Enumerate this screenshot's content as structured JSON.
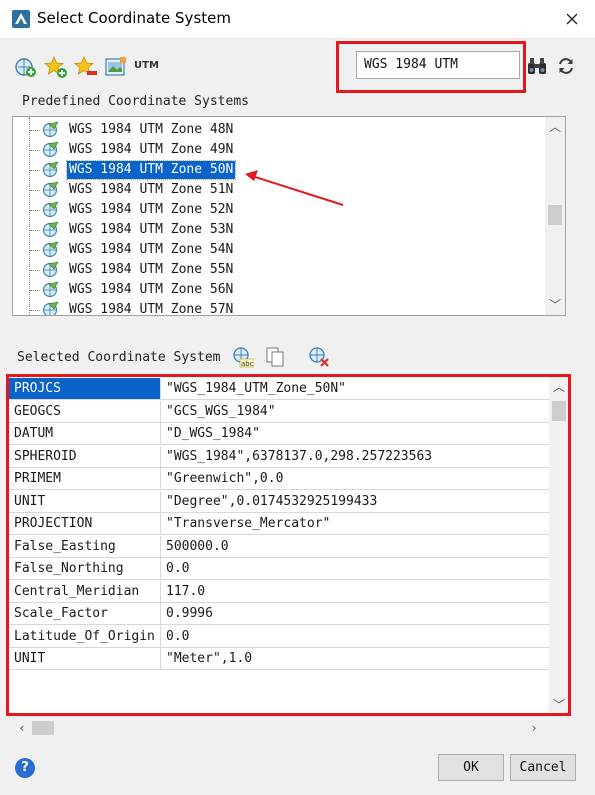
{
  "window": {
    "title": "Select Coordinate System"
  },
  "toolbar": {
    "utm_label": "UTM",
    "search_value": "WGS 1984 UTM",
    "icons": [
      "new-coordinate-system-icon",
      "add-favorite-icon",
      "remove-favorite-icon",
      "import-projection-icon",
      "find-icon",
      "refresh-icon"
    ]
  },
  "predefined": {
    "label": "Predefined Coordinate Systems",
    "items": [
      {
        "label": "WGS 1984 UTM Zone 48N",
        "selected": false
      },
      {
        "label": "WGS 1984 UTM Zone 49N",
        "selected": false
      },
      {
        "label": "WGS 1984 UTM Zone 50N",
        "selected": true
      },
      {
        "label": "WGS 1984 UTM Zone 51N",
        "selected": false
      },
      {
        "label": "WGS 1984 UTM Zone 52N",
        "selected": false
      },
      {
        "label": "WGS 1984 UTM Zone 53N",
        "selected": false
      },
      {
        "label": "WGS 1984 UTM Zone 54N",
        "selected": false
      },
      {
        "label": "WGS 1984 UTM Zone 55N",
        "selected": false
      },
      {
        "label": "WGS 1984 UTM Zone 56N",
        "selected": false
      },
      {
        "label": "WGS 1984 UTM Zone 57N",
        "selected": false
      }
    ]
  },
  "selected": {
    "label": "Selected Coordinate System",
    "properties": [
      {
        "key": "PROJCS",
        "value": "\"WGS_1984_UTM_Zone_50N\"",
        "selected": true
      },
      {
        "key": "GEOGCS",
        "value": "\"GCS_WGS_1984\"",
        "selected": false
      },
      {
        "key": "DATUM",
        "value": "\"D_WGS_1984\"",
        "selected": false
      },
      {
        "key": "SPHEROID",
        "value": "\"WGS_1984\",6378137.0,298.257223563",
        "selected": false
      },
      {
        "key": "PRIMEM",
        "value": "\"Greenwich\",0.0",
        "selected": false
      },
      {
        "key": "UNIT",
        "value": "\"Degree\",0.0174532925199433",
        "selected": false
      },
      {
        "key": "PROJECTION",
        "value": "\"Transverse_Mercator\"",
        "selected": false
      },
      {
        "key": "False_Easting",
        "value": "500000.0",
        "selected": false
      },
      {
        "key": "False_Northing",
        "value": "0.0",
        "selected": false
      },
      {
        "key": "Central_Meridian",
        "value": "117.0",
        "selected": false
      },
      {
        "key": "Scale_Factor",
        "value": "0.9996",
        "selected": false
      },
      {
        "key": "Latitude_Of_Origin",
        "value": "0.0",
        "selected": false
      },
      {
        "key": "UNIT",
        "value": "\"Meter\",1.0",
        "selected": false
      }
    ]
  },
  "buttons": {
    "ok": "OK",
    "cancel": "Cancel",
    "help": "?"
  },
  "colors": {
    "selection": "#0a63c9",
    "annotation": "#e5161c"
  }
}
